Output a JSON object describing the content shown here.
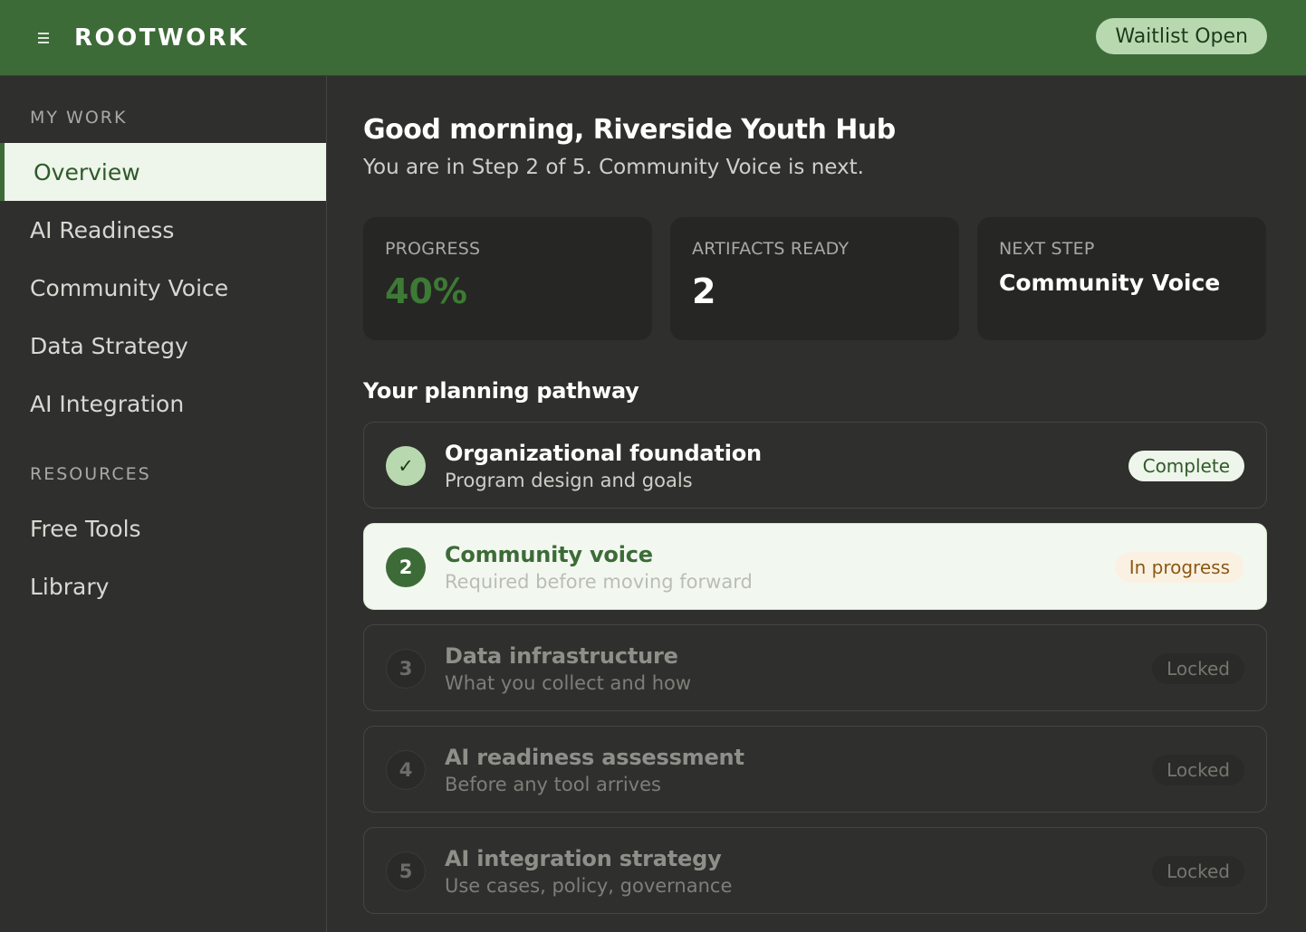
{
  "header": {
    "menu_icon": "hamburger-icon",
    "brand": "ROOTWORK",
    "waitlist_label": "Waitlist Open"
  },
  "sidebar": {
    "sections": [
      {
        "title": "MY WORK",
        "items": [
          {
            "label": "Overview",
            "active": true
          },
          {
            "label": "AI Readiness"
          },
          {
            "label": "Community Voice"
          },
          {
            "label": "Data Strategy"
          },
          {
            "label": "AI Integration"
          }
        ]
      },
      {
        "title": "RESOURCES",
        "items": [
          {
            "label": "Free Tools"
          },
          {
            "label": "Library"
          }
        ]
      }
    ]
  },
  "main": {
    "greeting": "Good morning, Riverside Youth Hub",
    "subtitle": "You are in Step 2 of 5. Community Voice is next.",
    "stats": [
      {
        "label": "PROGRESS",
        "value": "40%"
      },
      {
        "label": "ARTIFACTS READY",
        "value": "2"
      },
      {
        "label": "NEXT STEP",
        "value": "Community Voice"
      }
    ],
    "pathway_title": "Your planning pathway",
    "steps": [
      {
        "marker": "✓",
        "title": "Organizational foundation",
        "desc": "Program design and goals",
        "status": "Complete"
      },
      {
        "marker": "2",
        "title": "Community voice",
        "desc": "Required before moving forward",
        "status": "In progress"
      },
      {
        "marker": "3",
        "title": "Data infrastructure",
        "desc": "What you collect and how",
        "status": "Locked"
      },
      {
        "marker": "4",
        "title": "AI readiness assessment",
        "desc": "Before any tool arrives",
        "status": "Locked"
      },
      {
        "marker": "5",
        "title": "AI integration strategy",
        "desc": "Use cases, policy, governance",
        "status": "Locked"
      }
    ]
  },
  "colors": {
    "brand_green": "#3d6b38",
    "accent_light_green": "#b8d9b0",
    "background": "#2f2f2d",
    "card": "#262624",
    "in_progress_text": "#8a5a12"
  }
}
